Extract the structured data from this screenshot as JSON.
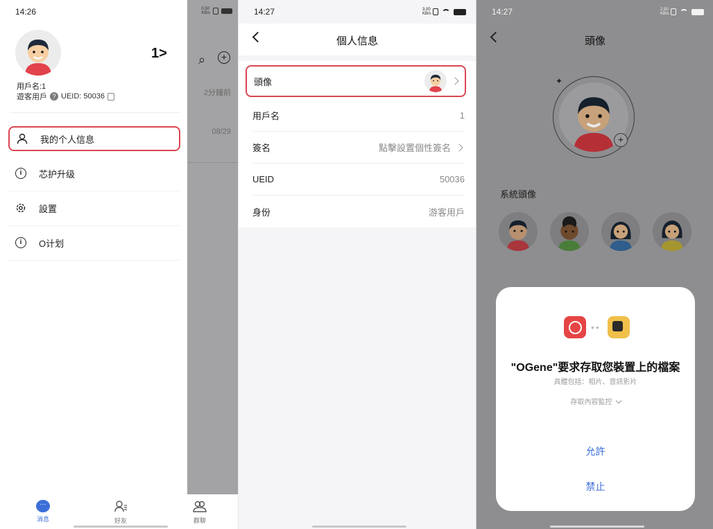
{
  "panel1": {
    "status_time": "14:26",
    "status_net": "0.50\nKB/s",
    "level_label": "1>",
    "username_label": "用戶名:1",
    "account_type": "遊客用戶",
    "ueid_label": "UEID: 50036",
    "backdrop_time1": "2分鐘前",
    "backdrop_time2": "08/29",
    "menu": [
      {
        "label": "我的个人信息"
      },
      {
        "label": "芯护升级"
      },
      {
        "label": "設置"
      },
      {
        "label": "O计划"
      }
    ],
    "tabs": [
      {
        "label": "消息"
      },
      {
        "label": "好友"
      },
      {
        "label": "群聊"
      }
    ],
    "accent": "#3b6fd8",
    "highlight": "#d94752"
  },
  "panel2": {
    "status_time": "14:27",
    "status_net": "3.00\nKB/s",
    "title": "個人信息",
    "rows": [
      {
        "label": "頭像",
        "value": ""
      },
      {
        "label": "用戶名",
        "value": "1"
      },
      {
        "label": "簽名",
        "value": "點擊設置個性簽名"
      },
      {
        "label": "UEID",
        "value": "50036"
      },
      {
        "label": "身份",
        "value": "游客用戶"
      }
    ]
  },
  "panel3": {
    "status_time": "14:27",
    "status_net": "2.50\nKB/s",
    "title": "頭像",
    "system_avatars_title": "系統頭像",
    "dialog": {
      "title": "\"OGene\"要求存取您裝置上的檔案",
      "subtitle": "具體包括：相片、音訊影片",
      "detail": "存取內容監控",
      "allow": "允許",
      "deny": "禁止"
    }
  }
}
